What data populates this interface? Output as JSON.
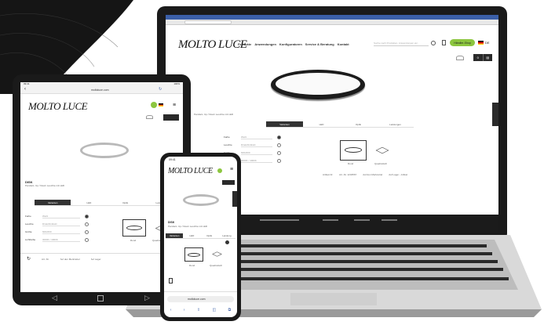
{
  "brand": {
    "logo_text": "MOLTO LUCE",
    "accent_green": "#8cc63f",
    "dark": "#2a2a2a",
    "footer_dark": "#1b1b1b"
  },
  "laptop": {
    "nav": {
      "items": [
        "Produkte",
        "Anwendungen",
        "Konfiguratoren",
        "Service & Beratung",
        "Kontakt"
      ],
      "search_placeholder": "Suche nach Produkten, Anwendungen etc.",
      "cta": "Händler-Shop",
      "lang": "DE"
    },
    "product": {
      "subtitle": "Pendant- Up / Down Leuchte mit LED"
    },
    "tabs": [
      "Varianten",
      "LED",
      "Optik",
      "Leistungen"
    ],
    "rows": [
      {
        "label": "Farbe",
        "value": "Weiß"
      },
      {
        "label": "Leuchte",
        "value": "Direkt/Indirekt"
      },
      {
        "label": "Größe",
        "value": "600x600"
      },
      {
        "label": "Lichtfarbe",
        "value": "3000K / 4000K"
      }
    ],
    "shape_labels": [
      "Rund",
      "Quadratisch"
    ],
    "order_bar": [
      "Artikel-Nr.",
      "Art.-Nr. 1234567",
      "Auf den Merkzettel",
      "Auf Lager - Artikel",
      "Kontakt"
    ]
  },
  "tablet": {
    "status_left": "09:41",
    "status_right": "100%",
    "url": "moltoluce.com",
    "product": {
      "title": "DISK",
      "subtitle": "Pendant- Up / Down Leuchte mit LED"
    },
    "tabs": [
      "Varianten",
      "LED",
      "Optik",
      "Leistungen"
    ],
    "rows": [
      {
        "label": "Farbe",
        "value": "Weiß"
      },
      {
        "label": "Leuchte",
        "value": "Direkt/Indirekt"
      },
      {
        "label": "Größe",
        "value": "600x600"
      },
      {
        "label": "Lichtfarbe",
        "value": "3000K / 4000K"
      }
    ],
    "shape_labels": [
      "Rund",
      "Quadratisch"
    ],
    "bottom_bar": [
      "Art.-Nr.",
      "Auf den Merkzettel",
      "Auf Lager"
    ]
  },
  "phone": {
    "status_left": "09:41",
    "product": {
      "title": "DISK",
      "subtitle": "Pendant- Up / Down Leuchte mit LED"
    },
    "tabs": [
      "Varianten",
      "LED",
      "Optik",
      "Leistung"
    ],
    "shape_labels": [
      "Rund",
      "Quadratisch"
    ],
    "url": "moltoluce.com"
  }
}
